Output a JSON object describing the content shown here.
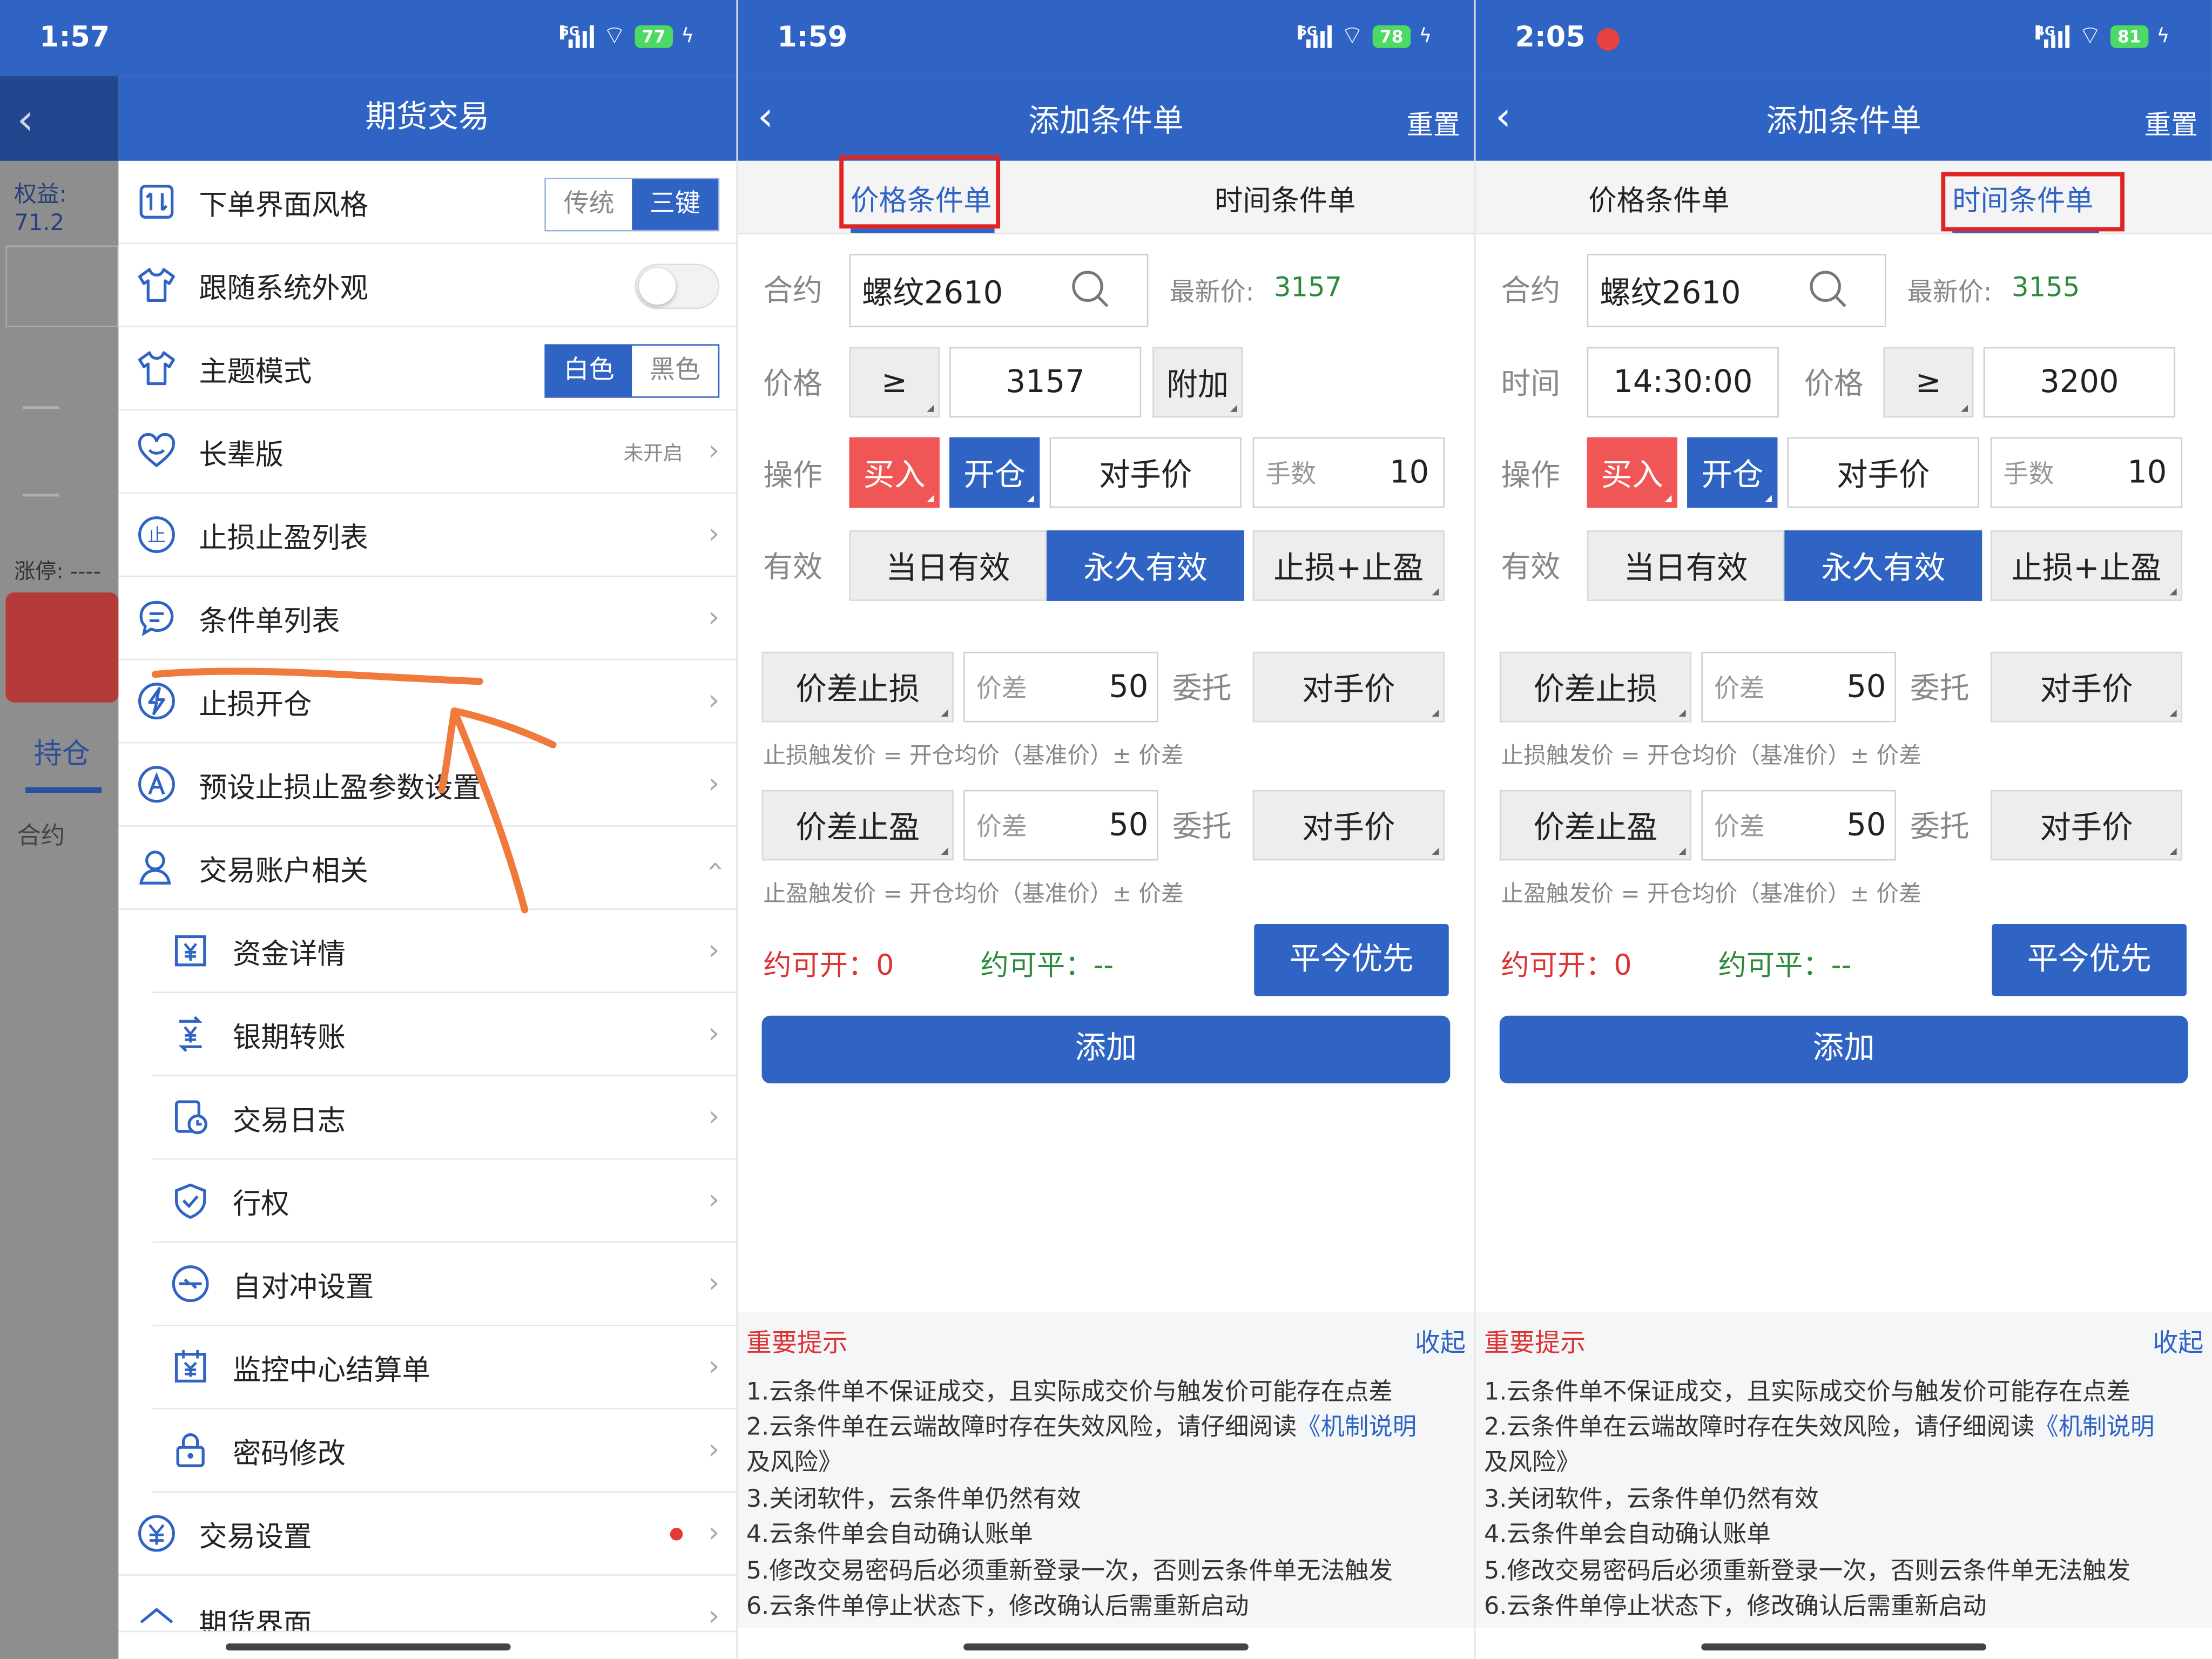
{
  "panel1": {
    "status": {
      "time": "1:57",
      "network": "5G",
      "battery": "77"
    },
    "side": {
      "equity": "权益: 71.2",
      "limit": "涨停: ----",
      "holding_tab": "持仓",
      "col_contract": "合约"
    },
    "title": "期货交易",
    "style_row": {
      "label": "下单界面风格",
      "opt1": "传统",
      "opt2": "三键"
    },
    "follow_system": {
      "label": "跟随系统外观"
    },
    "theme": {
      "label": "主题模式",
      "opt1": "白色",
      "opt2": "黑色"
    },
    "elder": {
      "label": "长辈版",
      "status": "未开启"
    },
    "items": {
      "sl_list": "止损止盈列表",
      "cond_list": "条件单列表",
      "sl_open": "止损开仓",
      "preset": "预设止损止盈参数设置",
      "account": "交易账户相关",
      "funds": "资金详情",
      "transfer": "银期转账",
      "log": "交易日志",
      "exercise": "行权",
      "self_hedge": "自对冲设置",
      "settlement": "监控中心结算单",
      "password": "密码修改",
      "trade_settings": "交易设置",
      "futures_ui": "期货界面"
    },
    "icons": [
      "order-style-icon",
      "shirt-icon",
      "shirt-icon",
      "heart-icon",
      "stop-icon",
      "chat-icon",
      "bolt-icon",
      "a-icon",
      "user-icon",
      "yuan-icon",
      "transfer-icon",
      "log-icon",
      "shield-icon",
      "hedge-icon",
      "settlement-icon",
      "lock-icon",
      "yuan-circle-icon",
      "futures-icon"
    ]
  },
  "panel2": {
    "status": {
      "time": "1:59",
      "network": "5G",
      "battery": "78"
    },
    "nav": {
      "title": "添加条件单",
      "reset": "重置"
    },
    "tabs": {
      "price": "价格条件单",
      "time": "时间条件单",
      "active": "price"
    },
    "form": {
      "contract_label": "合约",
      "contract": "螺纹2610",
      "latest_label": "最新价:",
      "latest": "3157",
      "price_label": "价格",
      "op": "≥",
      "price": "3157",
      "extra": "附加",
      "action_label": "操作",
      "buy": "买入",
      "open": "开仓",
      "counter_price": "对手价",
      "qty_label": "手数",
      "qty": "10",
      "valid_label": "有效",
      "day": "当日有效",
      "forever": "永久有效",
      "slsp": "止损+止盈",
      "sl_btn": "价差止损",
      "diff_label": "价差",
      "sl_diff": "50",
      "entrust": "委托",
      "sl_price": "对手价",
      "sl_note": "止损触发价 = 开仓均价（基准价）± 价差",
      "tp_btn": "价差止盈",
      "tp_diff": "50",
      "tp_price": "对手价",
      "tp_note": "止盈触发价 = 开仓均价（基准价）± 价差",
      "can_open": "约可开：0",
      "can_close": "约可平：--",
      "close_today": "平今优先",
      "add": "添加"
    },
    "tips": {
      "title": "重要提示",
      "collapse": "收起",
      "l1": "1.云条件单不保证成交，且实际成交价与触发价可能存在点差",
      "l2a": "2.云条件单在云端故障时存在失效风险，请仔细阅读",
      "l2b": "《机制说明",
      "l2c": "及风险》",
      "l3": "3.关闭软件，云条件单仍然有效",
      "l4": "4.云条件单会自动确认账单",
      "l5": "5.修改交易密码后必须重新登录一次，否则云条件单无法触发",
      "l6": "6.云条件单停止状态下，修改确认后需重新启动"
    }
  },
  "panel3": {
    "status": {
      "time": "2:05",
      "network": "4G",
      "battery": "81"
    },
    "nav": {
      "title": "添加条件单",
      "reset": "重置"
    },
    "tabs": {
      "price": "价格条件单",
      "time": "时间条件单",
      "active": "time"
    },
    "form": {
      "contract_label": "合约",
      "contract": "螺纹2610",
      "latest_label": "最新价:",
      "latest": "3155",
      "time_label": "时间",
      "time": "14:30:00",
      "price_label": "价格",
      "op": "≥",
      "price": "3200",
      "action_label": "操作",
      "buy": "买入",
      "open": "开仓",
      "counter_price": "对手价",
      "qty_label": "手数",
      "qty": "10",
      "valid_label": "有效",
      "day": "当日有效",
      "forever": "永久有效",
      "slsp": "止损+止盈",
      "sl_btn": "价差止损",
      "diff_label": "价差",
      "sl_diff": "50",
      "entrust": "委托",
      "sl_price": "对手价",
      "sl_note": "止损触发价 = 开仓均价（基准价）± 价差",
      "tp_btn": "价差止盈",
      "tp_diff": "50",
      "tp_price": "对手价",
      "tp_note": "止盈触发价 = 开仓均价（基准价）± 价差",
      "can_open": "约可开：0",
      "can_close": "约可平：--",
      "close_today": "平今优先",
      "add": "添加"
    },
    "tips": {
      "title": "重要提示",
      "collapse": "收起",
      "l1": "1.云条件单不保证成交，且实际成交价与触发价可能存在点差",
      "l2a": "2.云条件单在云端故障时存在失效风险，请仔细阅读",
      "l2b": "《机制说明",
      "l2c": "及风险》",
      "l3": "3.关闭软件，云条件单仍然有效",
      "l4": "4.云条件单会自动确认账单",
      "l5": "5.修改交易密码后必须重新登录一次，否则云条件单无法触发",
      "l6": "6.云条件单停止状态下，修改确认后需重新启动"
    }
  },
  "colors": {
    "primary": "#2f63c4",
    "buy_red": "#f05656",
    "annotation_orange": "#f07a3c",
    "highlight_red": "#e02424",
    "green": "#2e8b3e"
  }
}
